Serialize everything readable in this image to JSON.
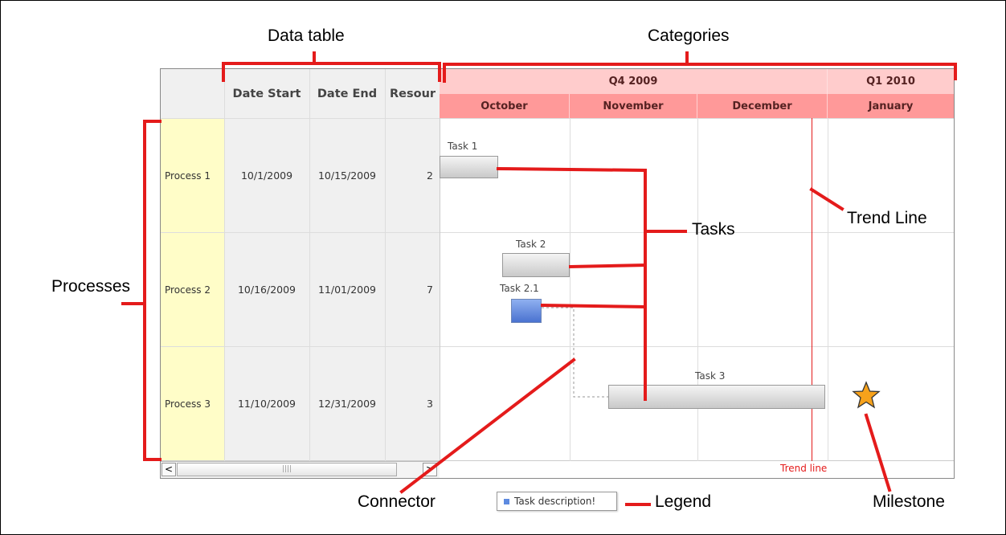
{
  "callouts": {
    "data_table": "Data table",
    "categories": "Categories",
    "processes": "Processes",
    "tasks": "Tasks",
    "trend_line": "Trend Line",
    "connector": "Connector",
    "legend": "Legend",
    "milestone": "Milestone"
  },
  "table": {
    "headers": [
      "Date Start",
      "Date End",
      "Resour"
    ],
    "rows": [
      {
        "process": "Process 1",
        "start": "10/1/2009",
        "end": "10/15/2009",
        "resource": "2"
      },
      {
        "process": "Process 2",
        "start": "10/16/2009",
        "end": "11/01/2009",
        "resource": "7"
      },
      {
        "process": "Process 3",
        "start": "11/10/2009",
        "end": "12/31/2009",
        "resource": "3"
      }
    ],
    "scroll_left": "<",
    "scroll_right": ">",
    "scroll_grip": "||||"
  },
  "categories": {
    "quarters": [
      "Q4 2009",
      "Q1 2010"
    ],
    "months": [
      "October",
      "November",
      "December",
      "January"
    ]
  },
  "tasks": {
    "task1": "Task 1",
    "task2": "Task 2",
    "task21": "Task 2.1",
    "task3": "Task 3"
  },
  "trend_line_label": "Trend line",
  "legend_text": "Task description!",
  "colors": {
    "annotation": "#e41b1b",
    "process_bg": "#fffdc8",
    "quarter_bg": "#ffcccc",
    "month_bg": "#ff9999",
    "highlight_task": "#5d8ae0",
    "milestone": "#f7a21b"
  }
}
